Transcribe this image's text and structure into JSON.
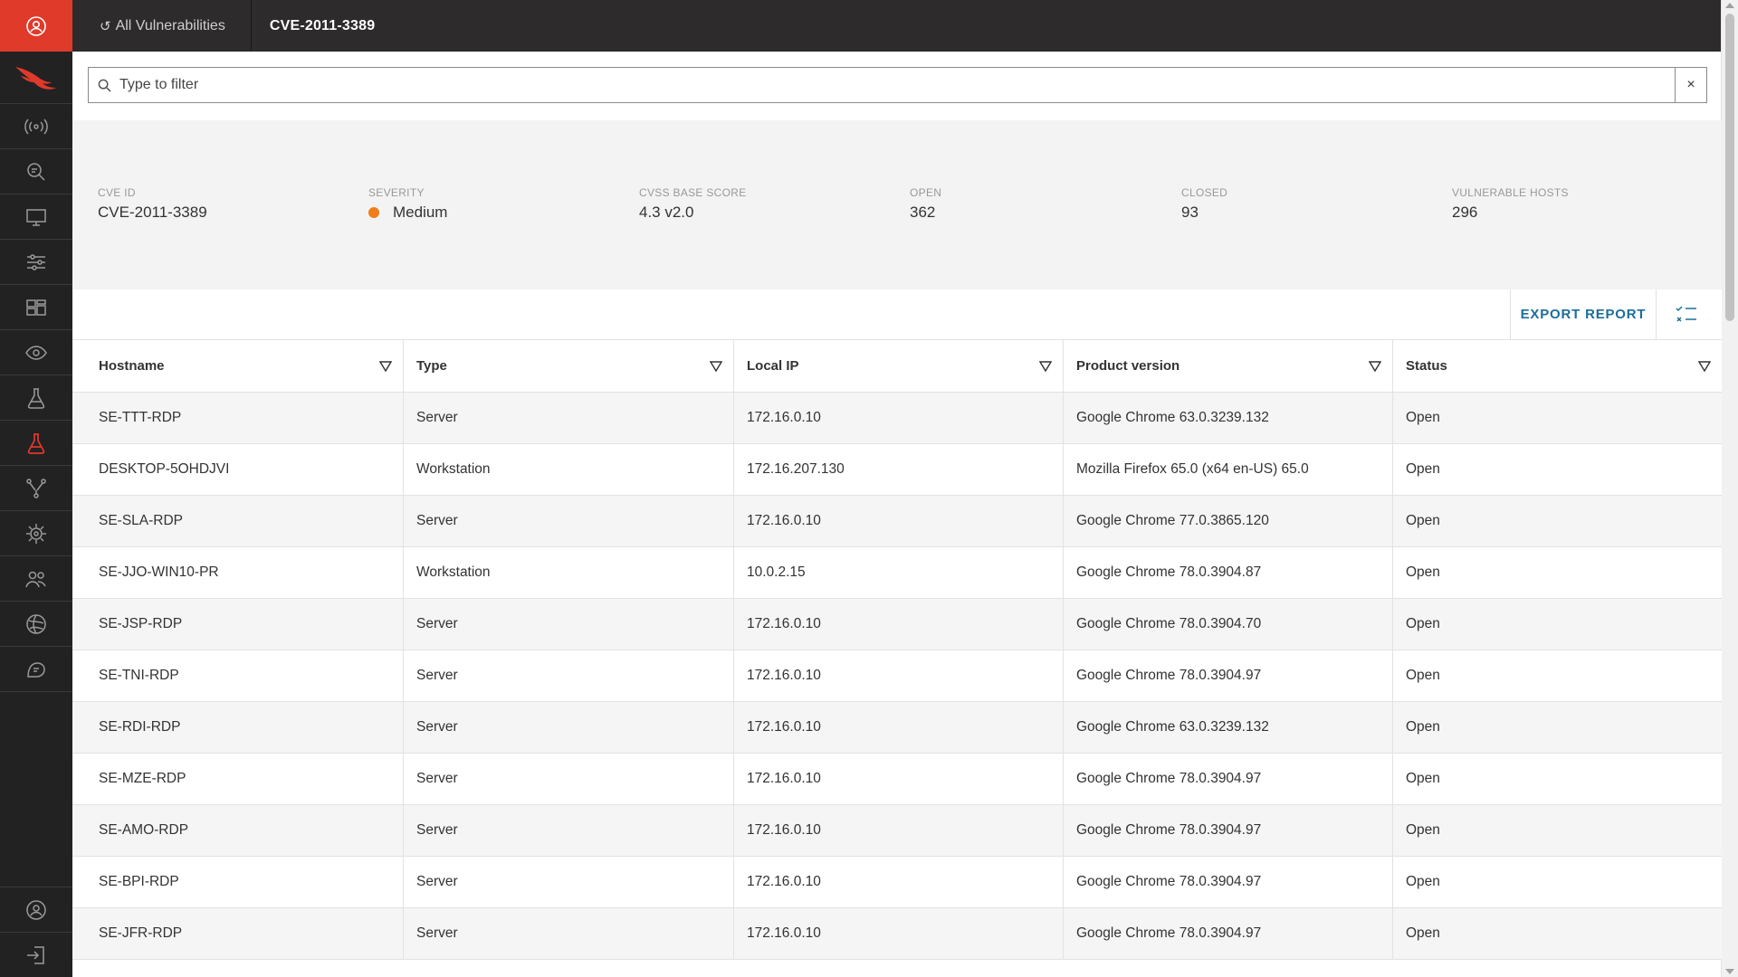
{
  "topbar": {
    "back_label": "All Vulnerabilities",
    "back_icon": "return-arrow-icon",
    "current": "CVE-2011-3389"
  },
  "rail": {
    "top_icon": "user-circle-icon",
    "logo": "falcon-logo",
    "items": [
      "signal-icon",
      "search-scan-icon",
      "monitor-icon",
      "sliders-icon",
      "dashboard-icon",
      "eye-icon",
      "flask-icon",
      "flask-active-icon",
      "branch-icon",
      "target-icon",
      "users-icon",
      "globe-icon",
      "chat-icon"
    ],
    "bottom_items": [
      "account-icon",
      "logout-icon"
    ],
    "active_color": "#e03a2b"
  },
  "filter": {
    "placeholder": "Type to filter",
    "value": "",
    "clear": "×"
  },
  "summary": {
    "cve_id": {
      "label": "CVE ID",
      "value": "CVE-2011-3389"
    },
    "severity": {
      "label": "SEVERITY",
      "value": "Medium",
      "color": "#f07c1a"
    },
    "cvss": {
      "label": "CVSS BASE SCORE",
      "value": "4.3 v2.0"
    },
    "open": {
      "label": "OPEN",
      "value": "362"
    },
    "closed": {
      "label": "CLOSED",
      "value": "93"
    },
    "hosts": {
      "label": "VULNERABLE HOSTS",
      "value": "296"
    }
  },
  "toolbar": {
    "export_label": "EXPORT REPORT",
    "columns_icon": "checklist-icon"
  },
  "table": {
    "columns": [
      "Hostname",
      "Type",
      "Local IP",
      "Product version",
      "Status"
    ],
    "rows": [
      [
        "SE-TTT-RDP",
        "Server",
        "172.16.0.10",
        "Google Chrome 63.0.3239.132",
        "Open"
      ],
      [
        "DESKTOP-5OHDJVI",
        "Workstation",
        "172.16.207.130",
        "Mozilla Firefox 65.0 (x64 en-US) 65.0",
        "Open"
      ],
      [
        "SE-SLA-RDP",
        "Server",
        "172.16.0.10",
        "Google Chrome 77.0.3865.120",
        "Open"
      ],
      [
        "SE-JJO-WIN10-PR",
        "Workstation",
        "10.0.2.15",
        "Google Chrome 78.0.3904.87",
        "Open"
      ],
      [
        "SE-JSP-RDP",
        "Server",
        "172.16.0.10",
        "Google Chrome 78.0.3904.70",
        "Open"
      ],
      [
        "SE-TNI-RDP",
        "Server",
        "172.16.0.10",
        "Google Chrome 78.0.3904.97",
        "Open"
      ],
      [
        "SE-RDI-RDP",
        "Server",
        "172.16.0.10",
        "Google Chrome 63.0.3239.132",
        "Open"
      ],
      [
        "SE-MZE-RDP",
        "Server",
        "172.16.0.10",
        "Google Chrome 78.0.3904.97",
        "Open"
      ],
      [
        "SE-AMO-RDP",
        "Server",
        "172.16.0.10",
        "Google Chrome 78.0.3904.97",
        "Open"
      ],
      [
        "SE-BPI-RDP",
        "Server",
        "172.16.0.10",
        "Google Chrome 78.0.3904.97",
        "Open"
      ],
      [
        "SE-JFR-RDP",
        "Server",
        "172.16.0.10",
        "Google Chrome 78.0.3904.97",
        "Open"
      ]
    ]
  }
}
